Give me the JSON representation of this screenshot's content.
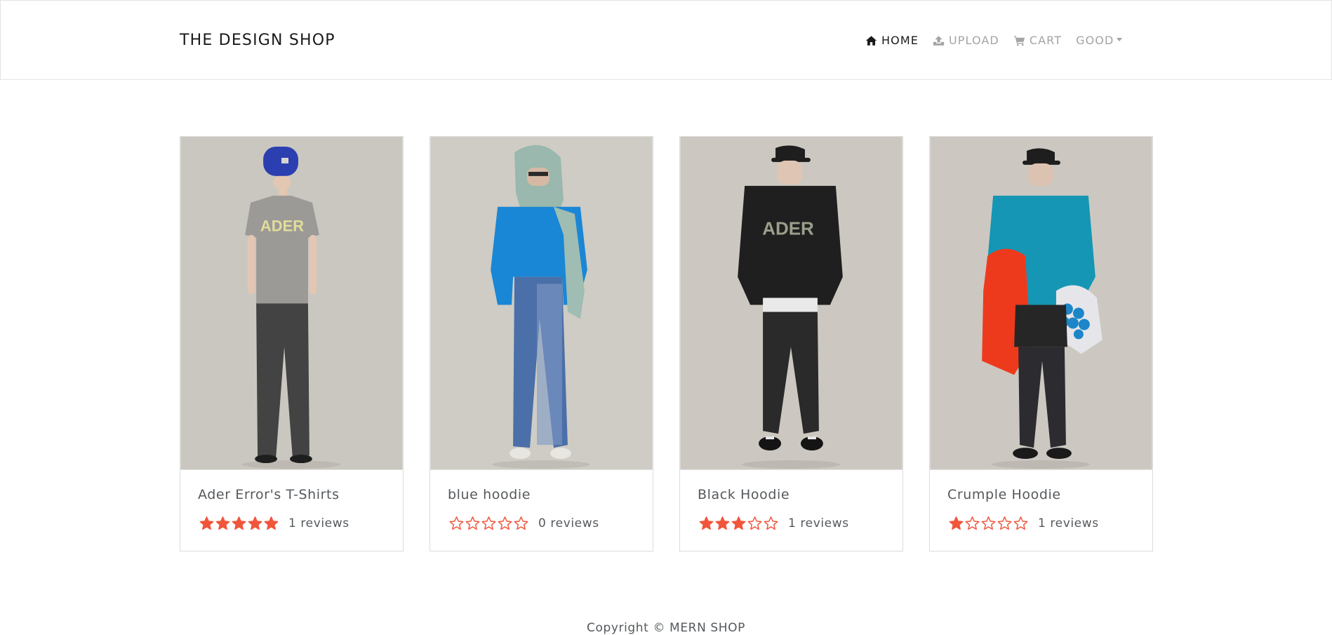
{
  "brand": "THE DESIGN SHOP",
  "nav": {
    "home": "HOME",
    "upload": "UPLOAD",
    "cart": "CART",
    "user": "GOOD"
  },
  "colors": {
    "star": "#f1553a",
    "text": "#55595c",
    "nav_muted": "#a2a4a6",
    "nav_active": "#1a1a1a"
  },
  "products": [
    {
      "name": "Ader Error's T-Shirts",
      "rating": 5,
      "reviews": "1 reviews"
    },
    {
      "name": "blue hoodie",
      "rating": 0,
      "reviews": "0 reviews"
    },
    {
      "name": "Black Hoodie",
      "rating": 3,
      "reviews": "1 reviews"
    },
    {
      "name": "Crumple Hoodie",
      "rating": 1,
      "reviews": "1 reviews"
    }
  ],
  "footer": "Copyright © MERN SHOP"
}
